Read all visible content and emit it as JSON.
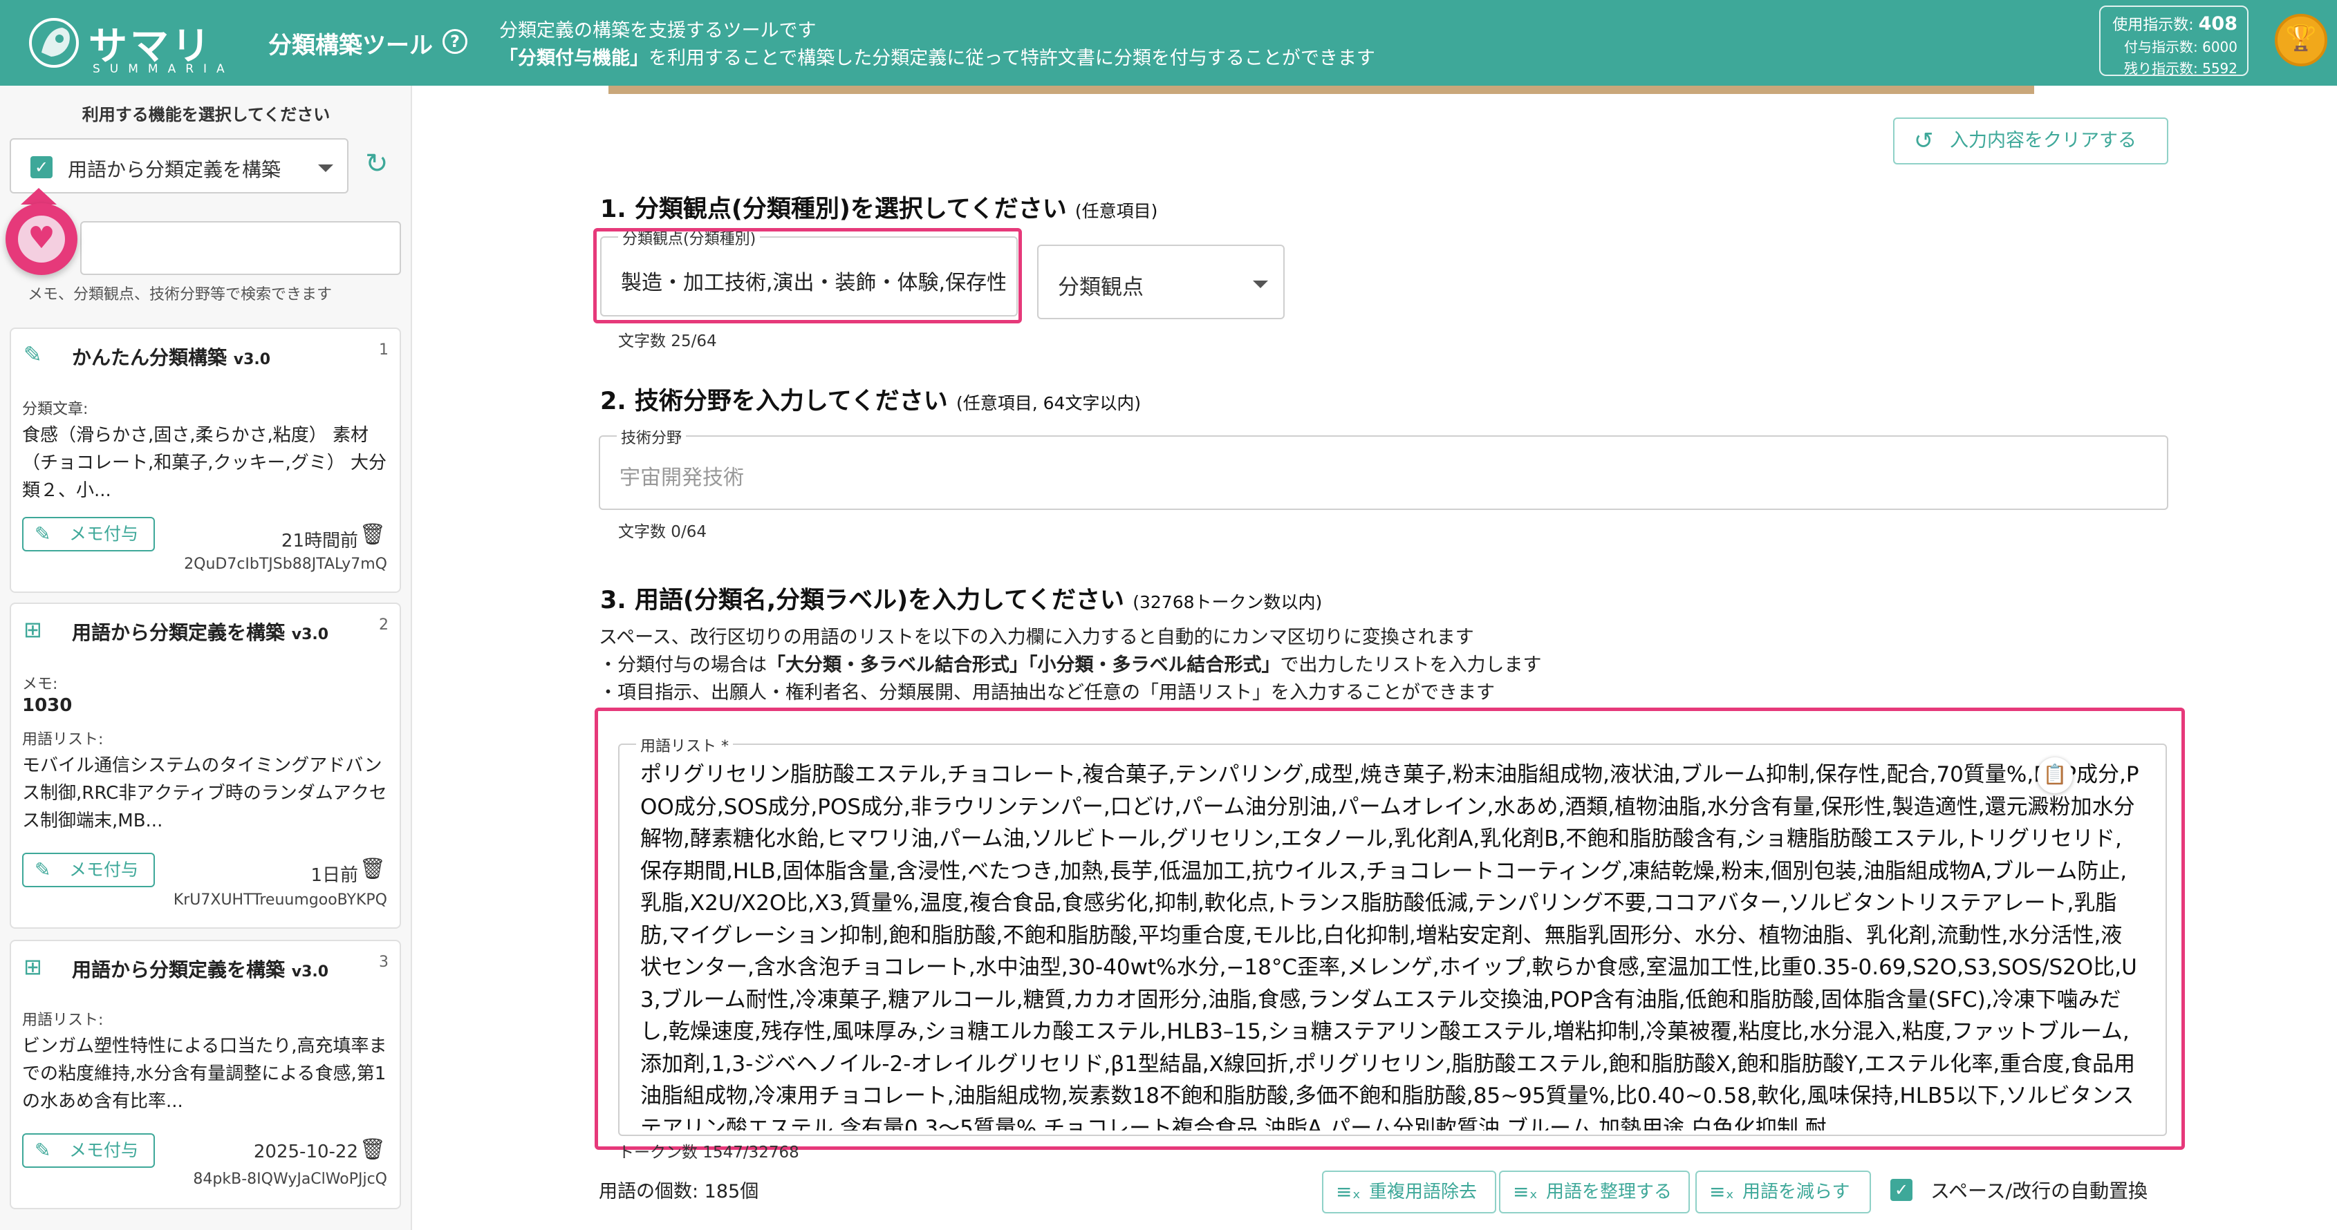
{
  "header": {
    "logo_jp": "サマリア",
    "logo_en": "SUMMARIA",
    "tool_title": "分類構築ツール",
    "desc_line1": "分類定義の構築を支援するツールです",
    "desc_line2_bold": "「分類付与機能」",
    "desc_line2_rest": "を利用することで構築した分類定義に従って特許文書に分類を付与することができます",
    "usage": {
      "used_label": "使用指示数:",
      "used_value": "408",
      "granted": "付与指示数: 6000",
      "remaining": "残り指示数: 5592"
    },
    "colors": {
      "brand": "#3ea899",
      "accent": "#e6397a",
      "trophy": "#f1a81b"
    }
  },
  "sidebar": {
    "label": "利用する機能を選択してください",
    "function_select": "用語から分類定義を構築",
    "search_hint": "メモ、分類観点、技術分野等で検索できます",
    "cards": [
      {
        "icon": "magic-wand-icon",
        "title": "かんたん分類構築",
        "version": "v3.0",
        "num": "1",
        "label": "分類文章:",
        "body": "食感（滑らかさ,固さ,柔らかさ,粘度） 素材（チョコレート,和菓子,クッキー,グミ） 大分類２、小...",
        "memo_btn": "メモ付与",
        "date": "21時間前",
        "id": "2QuD7cIbTJSb88JTALy7mQ"
      },
      {
        "icon": "hierarchy-icon",
        "title": "用語から分類定義を構築",
        "version": "v3.0",
        "num": "2",
        "memo_label": "メモ:",
        "memo_value": "1030",
        "label": "用語リスト:",
        "body": "モバイル通信システムのタイミングアドバンス制御,RRC非アクティブ時のランダムアクセス制御端末,MB...",
        "memo_btn": "メモ付与",
        "date": "1日前",
        "id": "KrU7XUHTTreuumgooBYKPQ"
      },
      {
        "icon": "hierarchy-icon",
        "title": "用語から分類定義を構築",
        "version": "v3.0",
        "num": "3",
        "label": "用語リスト:",
        "body": "ビンガム塑性特性による口当たり,高充填率までの粘度維持,水分含有量調整による食感,第1の水あめ含有比率...",
        "memo_btn": "メモ付与",
        "date": "2025-10-22",
        "id": "84pkB-8IQWyJaClWoPJjcQ"
      }
    ]
  },
  "main": {
    "clear_button": "入力内容をクリアする",
    "step1": {
      "title": "1. 分類観点(分類種別)を選択してください",
      "sub": "(任意項目)",
      "field_label": "分類観点(分類種別)",
      "field_value": "製造・加工技術,演出・装飾・体験,保存性",
      "char_count": "文字数 25/64",
      "dropdown": "分類観点"
    },
    "step2": {
      "title": "2. 技術分野を入力してください",
      "sub": "(任意項目, 64文字以内)",
      "field_label": "技術分野",
      "placeholder": "宇宙開発技術",
      "char_count": "文字数 0/64"
    },
    "step3": {
      "title": "3. 用語(分類名,分類ラベル)を入力してください",
      "sub": "(32768トークン数以内)",
      "instr1": "スペース、改行区切りの用語のリストを以下の入力欄に入力すると自動的にカンマ区切りに変換されます",
      "instr2_a": "・分類付与の場合は",
      "instr2_b": "「大分類・多ラベル結合形式」「小分類・多ラベル結合形式」",
      "instr2_c": "で出力したリストを入力します",
      "instr3": "・項目指示、出願人・権利者名、分類展開、用語抽出など任意の「用語リスト」を入力することができます",
      "field_label": "用語リスト *",
      "terms": "ポリグリセリン脂肪酸エステル,チョコレート,複合菓子,テンパリング,成型,焼き菓子,粉末油脂組成物,液状油,ブルーム抑制,保存性,配合,70質量%,POP成分,POO成分,SOS成分,POS成分,非ラウリンテンパー,口どけ,パーム油分別油,パームオレイン,水あめ,酒類,植物油脂,水分含有量,保形性,製造適性,還元澱粉加水分解物,酵素糖化水飴,ヒマワリ油,パーム油,ソルビトール,グリセリン,エタノール,乳化剤A,乳化剤B,不飽和脂肪酸含有,ショ糖脂肪酸エステル,トリグリセリド,保存期間,HLB,固体脂含量,含浸性,べたつき,加熱,長芋,低温加工,抗ウイルス,チョコレートコーティング,凍結乾燥,粉末,個別包装,油脂組成物A,ブルーム防止,乳脂,X2U/X2O比,X3,質量%,温度,複合食品,食感劣化,抑制,軟化点,トランス脂肪酸低減,テンパリング不要,ココアバター,ソルビタントリステアレート,乳脂肪,マイグレーション抑制,飽和脂肪酸,不飽和脂肪酸,平均重合度,モル比,白化抑制,増粘安定剤、無脂乳固形分、水分、植物油脂、乳化剤,流動性,水分活性,液状センター,含水含泡チョコレート,水中油型,30-40wt%水分,−18°C歪率,メレンゲ,ホイップ,軟らか食感,室温加工性,比重0.35-0.69,S2O,S3,SOS/S2O比,U3,ブルーム耐性,冷凍菓子,糖アルコール,糖質,カカオ固形分,油脂,食感,ランダムエステル交換油,POP含有油脂,低飽和脂肪酸,固体脂含量(SFC),冷凍下噛みだし,乾燥速度,残存性,風味厚み,ショ糖エルカ酸エステル,HLB3–15,ショ糖ステアリン酸エステル,増粘抑制,冷菓被覆,粘度比,水分混入,粘度,ファットブルーム,添加剤,1,3-ジベヘノイル-2-オレイルグリセリド,β1型結晶,X線回折,ポリグリセリン,脂肪酸エステル,飽和脂肪酸X,飽和脂肪酸Y,エステル化率,重合度,食品用油脂組成物,冷凍用チョコレート,油脂組成物,炭素数18不飽和脂肪酸,多価不飽和脂肪酸,85~95質量%,比0.40~0.58,軟化,風味保持,HLB5以下,ソルビタンステアリン酸エステル,含有量0.3〜5質量%,チョコレート複合食品,油脂A,パーム分別軟質油,ブルーム,加熱用途,白色化抑制,耐",
      "token_count": "トークン数 1547/32768",
      "term_count": "用語の個数: 185個",
      "btn_dedupe": "重複用語除去",
      "btn_organize": "用語を整理する",
      "btn_reduce": "用語を減らす",
      "auto_replace": "スペース/改行の自動置換"
    }
  }
}
